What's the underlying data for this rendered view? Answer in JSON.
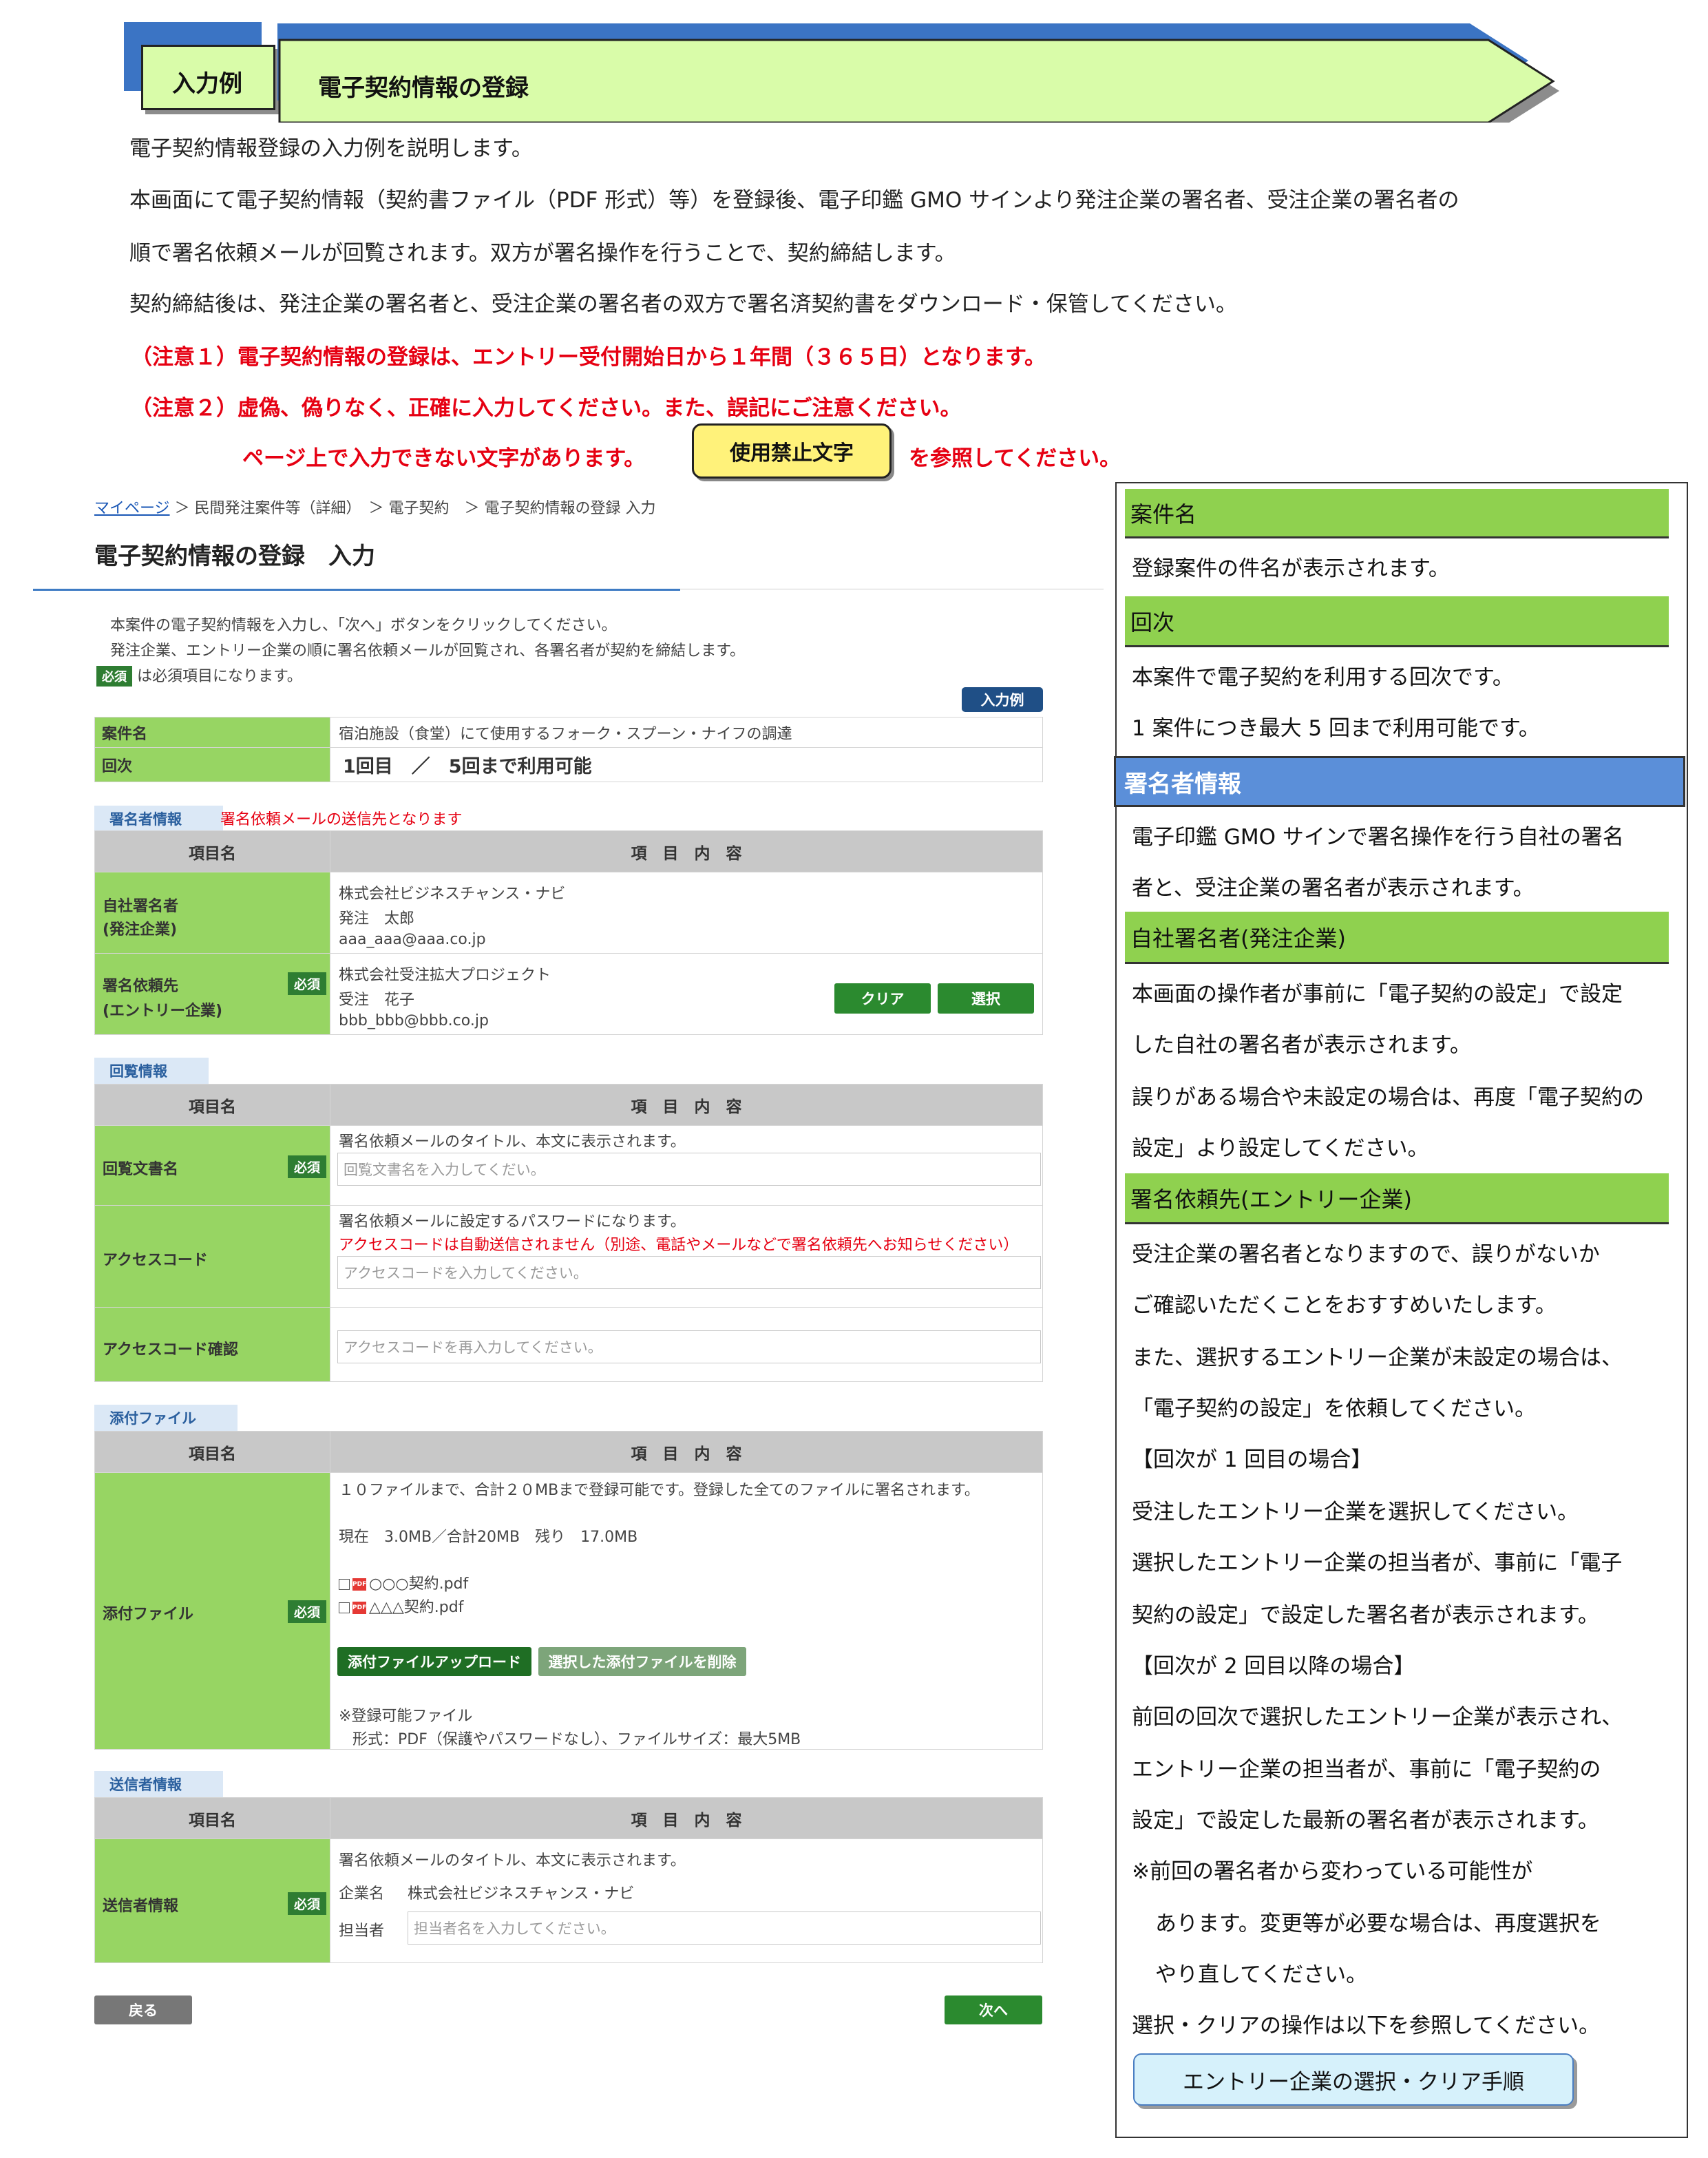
{
  "header": {
    "tag": "入力例",
    "title": "電子契約情報の登録"
  },
  "intro": [
    "電子契約情報登録の入力例を説明します。",
    "本画面にて電子契約情報（契約書ファイル（PDF 形式）等）を登録後、電子印鑑 GMO サインより発注企業の署名者、受注企業の署名者の",
    "順で署名依頼メールが回覧されます。双方が署名操作を行うことで、契約締結します。",
    "契約締結後は、発注企業の署名者と、受注企業の署名者の双方で署名済契約書をダウンロード・保管してください。"
  ],
  "warnings": {
    "w1": "（注意１）電子契約情報の登録は、エントリー受付開始日から１年間（３６５日）となります。",
    "w2": "（注意２）虚偽、偽りなく、正確に入力してください。また、誤記にご注意ください。",
    "w3a": "ページ上で入力できない文字があります。",
    "w3_button": "使用禁止文字",
    "w3b": "を参照してください。"
  },
  "colors": {
    "accent_green": "#97d563",
    "button_green": "#2b8a2f",
    "warning_red": "#e60012",
    "header_blue": "#3b74c4",
    "banner_green": "#d9fca9"
  },
  "form": {
    "breadcrumb": {
      "home": "マイページ",
      "rest": "＞ 民間発注案件等（詳細）　＞ 電子契約　＞ 電子契約情報の登録 入力"
    },
    "title": "電子契約情報の登録　入力",
    "desc1": "本案件の電子契約情報を入力し、「次へ」ボタンをクリックしてください。",
    "desc2": "発注企業、エントリー企業の順に署名依頼メールが回覧され、各署名者が契約を締結します。",
    "required_badge": "必須",
    "required_note": "は必須項目になります。",
    "example_badge": "入力例",
    "case_label": "案件名",
    "case_value": "宿泊施設（食堂）にて使用するフォーク・スプーン・ナイフの調達",
    "round_label": "回次",
    "round_value": "1回目　／　5回まで利用可能",
    "col_item": "項目名",
    "col_content": "項　目　内　容",
    "signer": {
      "section": "署名者情報",
      "section_note": "署名依頼メールの送信先となります",
      "self_label1": "自社署名者",
      "self_label2": "(発注企業)",
      "self_company": "株式会社ビジネスチャンス・ナビ",
      "self_name": "発注　太郎",
      "self_email": "aaa_aaa@aaa.co.jp",
      "req_label1": "署名依頼先",
      "req_label2": "(エントリー企業)",
      "req_company": "株式会社受注拡大プロジェクト",
      "req_name": "受注　花子",
      "req_email": "bbb_bbb@bbb.co.jp",
      "clear_btn": "クリア",
      "select_btn": "選択"
    },
    "circulation": {
      "section": "回覧情報",
      "doc_label": "回覧文書名",
      "doc_help": "署名依頼メールのタイトル、本文に表示されます。",
      "doc_placeholder": "回覧文書名を入力してくだい。",
      "code_label": "アクセスコード",
      "code_help": "署名依頼メールに設定するパスワードになります。",
      "code_warn": "アクセスコードは自動送信されません（別途、電話やメールなどで署名依頼先へお知らせください）",
      "code_placeholder": "アクセスコードを入力してください。",
      "confirm_label": "アクセスコード確認",
      "confirm_placeholder": "アクセスコードを再入力してください。"
    },
    "attachment": {
      "section": "添付ファイル",
      "label": "添付ファイル",
      "limit": "１０ファイルまで、合計２０MBまで登録可能です。登録した全てのファイルに署名されます。",
      "usage": "現在　3.0MB／合計20MB　残り　17.0MB",
      "pdf_icon": "PDF",
      "files": [
        "○○○契約.pdf",
        "△△△契約.pdf"
      ],
      "upload_btn": "添付ファイルアップロード",
      "delete_btn": "選択した添付ファイルを削除",
      "note1": "※登録可能ファイル",
      "note2": "形式：PDF（保護やパスワードなし）、ファイルサイズ：最大5MB"
    },
    "sender": {
      "section": "送信者情報",
      "label": "送信者情報",
      "help": "署名依頼メールのタイトル、本文に表示されます。",
      "company_label": "企業名",
      "company_value": "株式会社ビジネスチャンス・ナビ",
      "person_label": "担当者",
      "person_placeholder": "担当者名を入力してください。"
    },
    "back_btn": "戻る",
    "next_btn": "次へ"
  },
  "panel": {
    "case_head": "案件名",
    "case_text": "登録案件の件名が表示されます。",
    "round_head": "回次",
    "round_text1": "本案件で電子契約を利用する回次です。",
    "round_text2": "1 案件につき最大 5 回まで利用可能です。",
    "signer_head": "署名者情報",
    "signer_text1": "電子印鑑 GMO サインで署名操作を行う自社の署名",
    "signer_text2": "者と、受注企業の署名者が表示されます。",
    "self_head": "自社署名者(発注企業)",
    "self_text1": "本画面の操作者が事前に「電子契約の設定」で設定",
    "self_text2": "した自社の署名者が表示されます。",
    "self_text3": "誤りがある場合や未設定の場合は、再度「電子契約の",
    "self_text4": "設定」より設定してください。",
    "req_head": "署名依頼先(エントリー企業)",
    "req_text1": "受注企業の署名者となりますので、誤りがないか",
    "req_text2": "ご確認いただくことをおすすめいたします。",
    "req_text3": "また、選択するエントリー企業が未設定の場合は、",
    "req_text4": "「電子契約の設定」を依頼してください。",
    "req_text5": "【回次が 1 回目の場合】",
    "req_text6": "受注したエントリー企業を選択してください。",
    "req_text7": "選択したエントリー企業の担当者が、事前に「電子",
    "req_text8": "契約の設定」で設定した署名者が表示されます。",
    "req_text9": "【回次が 2 回目以降の場合】",
    "req_text10": "前回の回次で選択したエントリー企業が表示され、",
    "req_text11": "エントリー企業の担当者が、事前に「電子契約の",
    "req_text12": "設定」で設定した最新の署名者が表示されます。",
    "req_text13": "※前回の署名者から変わっている可能性が",
    "req_text14": "あります。変更等が必要な場合は、再度選択を",
    "req_text15": "やり直してください。",
    "req_text16": "選択・クリアの操作は以下を参照してください。",
    "link_btn": "エントリー企業の選択・クリア手順"
  }
}
